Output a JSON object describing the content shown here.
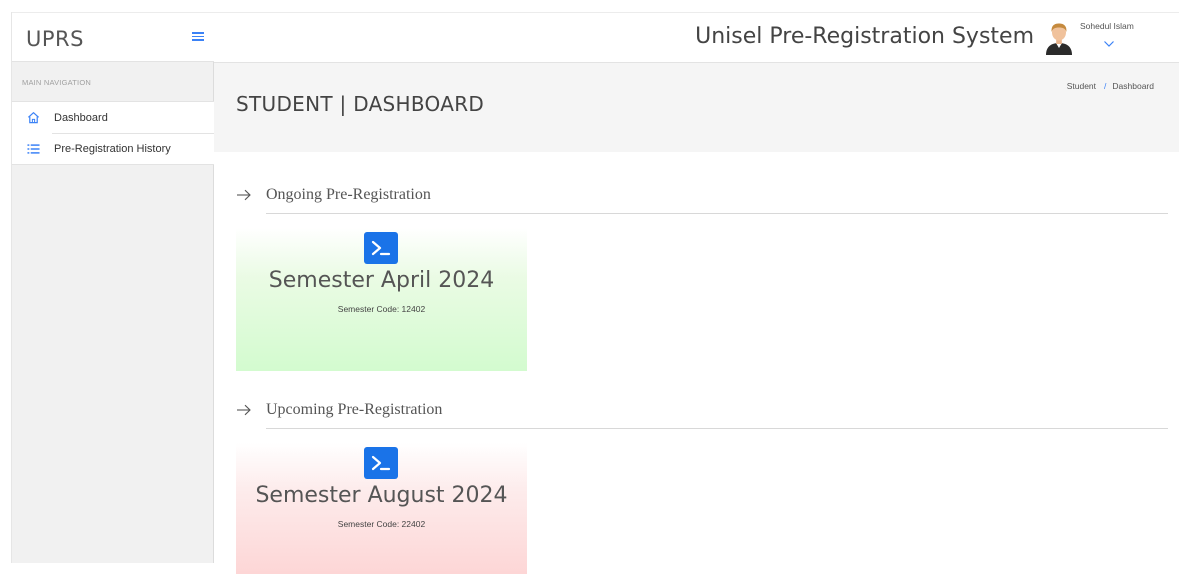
{
  "app": {
    "brand": "UPRS",
    "system_title": "Unisel Pre-Registration System"
  },
  "user": {
    "name": "Sohedul Islam"
  },
  "sidebar": {
    "heading": "MAIN NAVIGATION",
    "items": [
      {
        "label": "Dashboard",
        "icon": "home-icon"
      },
      {
        "label": "Pre-Registration History",
        "icon": "list-icon"
      }
    ]
  },
  "page": {
    "title": "STUDENT | DASHBOARD",
    "breadcrumb": {
      "root": "Student",
      "separator": "/",
      "current": "Dashboard"
    }
  },
  "sections": {
    "ongoing": {
      "heading": "Ongoing Pre-Registration",
      "card": {
        "title": "Semester April 2024",
        "code": "Semester Code: 12402"
      }
    },
    "upcoming": {
      "heading": "Upcoming Pre-Registration",
      "card": {
        "title": "Semester August 2024",
        "code": "Semester Code: 22402"
      }
    }
  },
  "colors": {
    "accent": "#3b82f6",
    "term_icon": "#1a73e8",
    "ongoing_card": "#d3fbcf",
    "upcoming_card": "#fdd6d6"
  }
}
